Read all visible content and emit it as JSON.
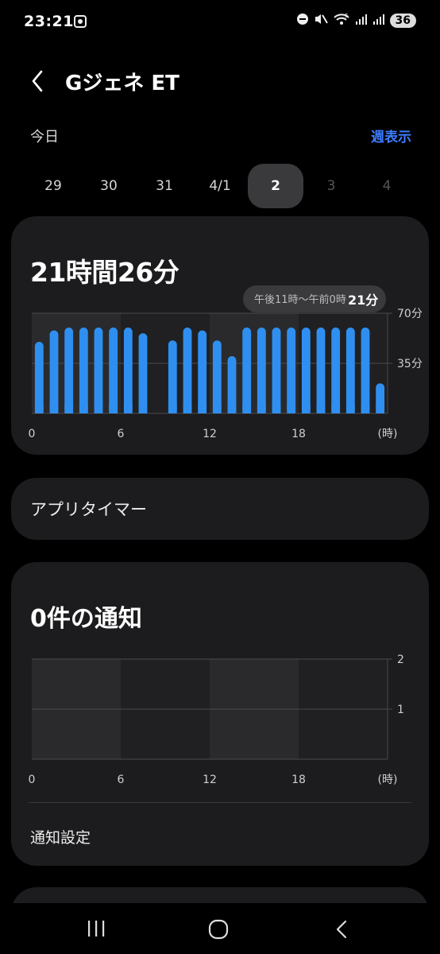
{
  "status_bar": {
    "time": "23:21",
    "battery": "36",
    "signal_label": "5"
  },
  "header": {
    "title": "Gジェネ ET"
  },
  "date_row": {
    "today_label": "今日",
    "weekly_label": "週表示",
    "days": [
      "29",
      "30",
      "31",
      "4/1",
      "2",
      "3",
      "4"
    ],
    "selected_index": 4
  },
  "usage": {
    "total": "21時間26分",
    "tooltip_range": "午後11時～午前0時",
    "tooltip_value": "21分"
  },
  "app_timer": {
    "label": "アプリタイマー"
  },
  "notifications": {
    "count": "0件の通知",
    "settings_label": "通知設定"
  },
  "colors": {
    "bar": "#2f8ff0",
    "accent": "#3d7cff",
    "card": "#1c1c1e"
  },
  "chart_data": [
    {
      "type": "bar",
      "title": "21時間26分",
      "xlabel": "(時)",
      "ylabel": "",
      "x_ticks": [
        "0",
        "6",
        "12",
        "18",
        "(時)"
      ],
      "y_ticks": [
        "70分",
        "35分"
      ],
      "ylim": [
        0,
        70
      ],
      "categories": [
        "0",
        "1",
        "2",
        "3",
        "4",
        "5",
        "6",
        "7",
        "8",
        "9",
        "10",
        "11",
        "12",
        "13",
        "14",
        "15",
        "16",
        "17",
        "18",
        "19",
        "20",
        "21",
        "22",
        "23"
      ],
      "values": [
        50,
        58,
        60,
        60,
        60,
        60,
        60,
        56,
        0,
        51,
        60,
        58,
        51,
        40,
        60,
        60,
        60,
        60,
        60,
        60,
        60,
        60,
        60,
        21
      ]
    },
    {
      "type": "bar",
      "title": "0件の通知",
      "xlabel": "(時)",
      "x_ticks": [
        "0",
        "6",
        "12",
        "18",
        "(時)"
      ],
      "y_ticks": [
        "2",
        "1"
      ],
      "ylim": [
        0,
        2
      ],
      "categories": [
        "0",
        "1",
        "2",
        "3",
        "4",
        "5",
        "6",
        "7",
        "8",
        "9",
        "10",
        "11",
        "12",
        "13",
        "14",
        "15",
        "16",
        "17",
        "18",
        "19",
        "20",
        "21",
        "22",
        "23"
      ],
      "values": [
        0,
        0,
        0,
        0,
        0,
        0,
        0,
        0,
        0,
        0,
        0,
        0,
        0,
        0,
        0,
        0,
        0,
        0,
        0,
        0,
        0,
        0,
        0,
        0
      ]
    }
  ]
}
